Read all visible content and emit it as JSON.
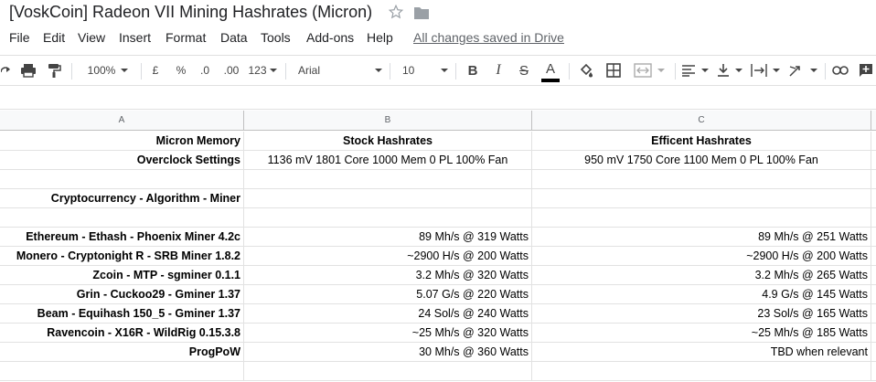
{
  "doc": {
    "title": "[VoskCoin] Radeon VII Mining Hashrates (Micron)",
    "save_status": "All changes saved in Drive"
  },
  "menu": [
    "File",
    "Edit",
    "View",
    "Insert",
    "Format",
    "Data",
    "Tools",
    "Add-ons",
    "Help"
  ],
  "toolbar": {
    "zoom": "100%",
    "currency": "£",
    "percent": "%",
    "decrease_decimal": ".0",
    "increase_decimal": ".00",
    "more_formats": "123",
    "font": "Arial",
    "font_size": "10",
    "bold": "B",
    "italic": "I",
    "strikethrough": "S",
    "text_color": "A",
    "text_color_value": "#000000"
  },
  "columns": [
    "A",
    "B",
    "C"
  ],
  "rows": [
    {
      "a": "Micron Memory",
      "b": "Stock Hashrates",
      "c": "Efficent Hashrates",
      "style": "header"
    },
    {
      "a": "Overclock Settings",
      "b": "1136 mV 1801 Core 1000 Mem 0 PL 100% Fan",
      "c": "950 mV 1750 Core 1100 Mem 0 PL 100% Fan",
      "style": "settings"
    },
    {
      "a": "",
      "b": "",
      "c": "",
      "style": "blank"
    },
    {
      "a": "Cryptocurrency - Algorithm - Miner",
      "b": "",
      "c": "",
      "style": "blank"
    },
    {
      "a": "",
      "b": "",
      "c": "",
      "style": "blank"
    },
    {
      "a": "Ethereum - Ethash - Phoenix Miner 4.2c",
      "b": "89 Mh/s @ 319 Watts",
      "c": "89 Mh/s @ 251 Watts",
      "style": "data"
    },
    {
      "a": "Monero - Cryptonight R - SRB Miner 1.8.2",
      "b": "~2900 H/s @ 200 Watts",
      "c": "~2900 H/s @ 200 Watts",
      "style": "data"
    },
    {
      "a": "Zcoin - MTP - sgminer 0.1.1",
      "b": "3.2 Mh/s @ 320 Watts",
      "c": "3.2 Mh/s @ 265 Watts",
      "style": "data"
    },
    {
      "a": "Grin - Cuckoo29 - Gminer 1.37",
      "b": "5.07 G/s @ 220 Watts",
      "c": "4.9 G/s @ 145 Watts",
      "style": "data"
    },
    {
      "a": "Beam - Equihash 150_5 - Gminer 1.37",
      "b": "24 Sol/s @ 240 Watts",
      "c": "23 Sol/s @ 165 Watts",
      "style": "data"
    },
    {
      "a": "Ravencoin - X16R - WildRig 0.15.3.8",
      "b": "~25 Mh/s @ 320 Watts",
      "c": "~25 Mh/s @ 185 Watts",
      "style": "data"
    },
    {
      "a": "ProgPoW",
      "b": "30 Mh/s @ 360 Watts",
      "c": "TBD when relevant",
      "style": "data"
    },
    {
      "a": "",
      "b": "",
      "c": "",
      "style": "blank"
    }
  ]
}
